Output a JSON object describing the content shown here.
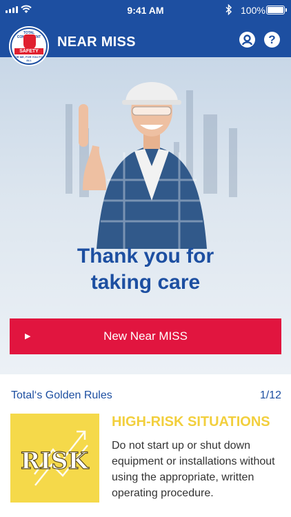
{
  "status_bar": {
    "time": "9:41 AM",
    "battery": "100%"
  },
  "header": {
    "title": "NEAR MISS"
  },
  "logo": {
    "top_text": "TOTAL COMMITMENT",
    "band_text": "SAFETY",
    "bottom_text": "FOR ME, FOR YOU FOR ALL"
  },
  "icons": {
    "profile": "profile-icon",
    "help": "help-icon",
    "help_glyph": "?"
  },
  "hero": {
    "line1": "Thank you for",
    "line2": "taking care"
  },
  "cta": {
    "arrow": "▶",
    "label": "New Near MISS"
  },
  "golden_rules": {
    "heading": "Total‘s Golden Rules",
    "counter": "1/12",
    "image_word": "RISK",
    "title": "HIGH-RISK SITUATIONS",
    "text": "Do not start up or shut down equipment or installations without using the appropriate, written operating procedure."
  },
  "colors": {
    "brand_blue": "#1d4fa1",
    "accent_red": "#e1153f",
    "rule_yellow": "#f2cf3d"
  }
}
